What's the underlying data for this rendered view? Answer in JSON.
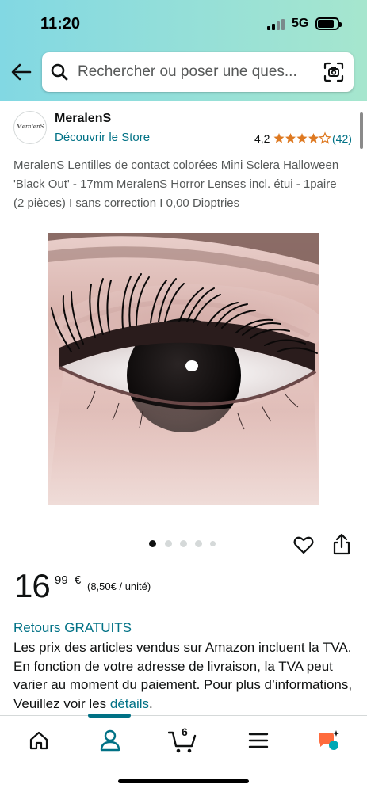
{
  "status_bar": {
    "time": "11:20",
    "network": "5G"
  },
  "search": {
    "placeholder": "Rechercher ou poser une ques..."
  },
  "seller": {
    "logo_text": "MeralenS",
    "name": "MeralenS",
    "store_link": "Découvrir le Store",
    "rating": "4,2",
    "stars": 4.2,
    "rating_count": "(42)"
  },
  "product": {
    "title": "MeralenS Lentilles de contact colorées Mini Sclera Halloween 'Black Out' - 17mm MeralenS Horror Lenses incl. étui - 1paire (2 pièces) I sans correction I 0,00 Dioptries",
    "image_icon": "eye-with-black-lens-image",
    "carousel": {
      "total": 5,
      "active": 1
    }
  },
  "price": {
    "whole": "16",
    "fraction": "99",
    "currency": "€",
    "unit_price": "(8,50€ / unité)"
  },
  "returns": {
    "label": "Retours GRATUITS"
  },
  "vat_notice": {
    "text": "Les prix des articles vendus sur Amazon incluent la TVA. En fonction de votre adresse de livraison, la TVA peut varier au moment du paiement. Pour plus d’informations, Veuillez voir les ",
    "link": "détails",
    "suffix": "."
  },
  "bottom_nav": {
    "items": [
      "home-icon",
      "account-icon",
      "cart-icon",
      "menu-icon",
      "rufus-ai-icon"
    ],
    "active": "account-icon",
    "cart_count": "6"
  },
  "colors": {
    "header_gradient_start": "#82d8e3",
    "header_gradient_end": "#a6e6ce",
    "link": "#007185",
    "star": "#de7921",
    "rufus_orange": "#ff6b3d",
    "rufus_teal": "#00a8b5"
  }
}
